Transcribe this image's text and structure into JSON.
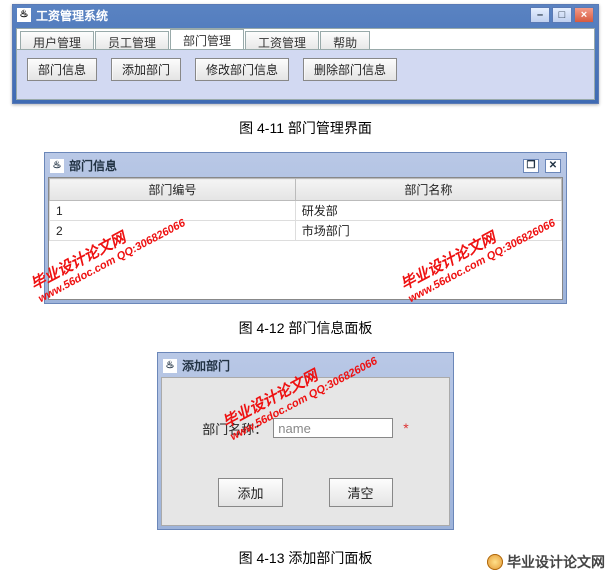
{
  "win1": {
    "title": "工资管理系统",
    "tabs": [
      "用户管理",
      "员工管理",
      "部门管理",
      "工资管理",
      "帮助"
    ],
    "activeTab": 2,
    "buttons": [
      "部门信息",
      "添加部门",
      "修改部门信息",
      "删除部门信息"
    ]
  },
  "caption1": "图 4-11  部门管理界面",
  "iframe1": {
    "title": "部门信息",
    "columns": [
      "部门编号",
      "部门名称"
    ],
    "rows": [
      {
        "id": "1",
        "name": "研发部"
      },
      {
        "id": "2",
        "name": "市场部门"
      }
    ]
  },
  "caption2": "图 4-12  部门信息面板",
  "iframe2": {
    "title": "添加部门",
    "label": "部门名称：",
    "placeholder": "name",
    "req": "*",
    "btn_add": "添加",
    "btn_clear": "清空"
  },
  "caption3": "图 4-13  添加部门面板",
  "watermark": {
    "line1": "毕业设计论文网",
    "line2": "www.56doc.com    QQ:306826066"
  },
  "footer": "毕业设计论文网"
}
